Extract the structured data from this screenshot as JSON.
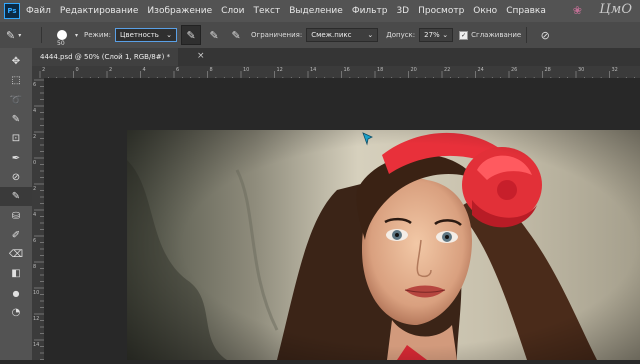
{
  "menubar": {
    "logo": "Ps",
    "items": [
      "Файл",
      "Редактирование",
      "Изображение",
      "Слои",
      "Текст",
      "Выделение",
      "Фильтр",
      "3D",
      "Просмотр",
      "Окно",
      "Справка"
    ],
    "watermark": "ЦмО"
  },
  "options": {
    "brush_size": "50",
    "mode_label": "Режим:",
    "mode_value": "Цветность",
    "limits_label": "Ограничения:",
    "limits_value": "Смеж.пикс",
    "tolerance_label": "Допуск:",
    "tolerance_value": "27%",
    "antialias_label": "Сглаживание",
    "antialias_checked": true
  },
  "tools": [
    {
      "name": "move-tool",
      "glyph": "✥"
    },
    {
      "name": "marquee-tool",
      "glyph": "⬚"
    },
    {
      "name": "lasso-tool",
      "glyph": "➰"
    },
    {
      "name": "quick-select-tool",
      "glyph": "✎"
    },
    {
      "name": "crop-tool",
      "glyph": "⊡"
    },
    {
      "name": "eyedropper-tool",
      "glyph": "✒"
    },
    {
      "name": "healing-tool",
      "glyph": "⊘"
    },
    {
      "name": "color-replacement-tool",
      "glyph": "✎",
      "active": true
    },
    {
      "name": "clone-stamp-tool",
      "glyph": "⛁"
    },
    {
      "name": "history-brush-tool",
      "glyph": "✐"
    },
    {
      "name": "eraser-tool",
      "glyph": "⌫"
    },
    {
      "name": "gradient-tool",
      "glyph": "◧"
    },
    {
      "name": "blur-tool",
      "glyph": "💧"
    },
    {
      "name": "dodge-tool",
      "glyph": "◔"
    }
  ],
  "document": {
    "tab_title": "4444.psd @ 50% (Слой 1, RGB/8#) *",
    "close": "×"
  },
  "rulers": {
    "h_marks": [
      "2",
      "0",
      "2",
      "4",
      "6",
      "8",
      "10",
      "12",
      "14",
      "16",
      "18",
      "20",
      "22",
      "24",
      "26",
      "28",
      "30",
      "32"
    ],
    "v_marks": [
      "6",
      "4",
      "2",
      "0",
      "2",
      "4",
      "6",
      "8",
      "10",
      "12",
      "14"
    ]
  }
}
